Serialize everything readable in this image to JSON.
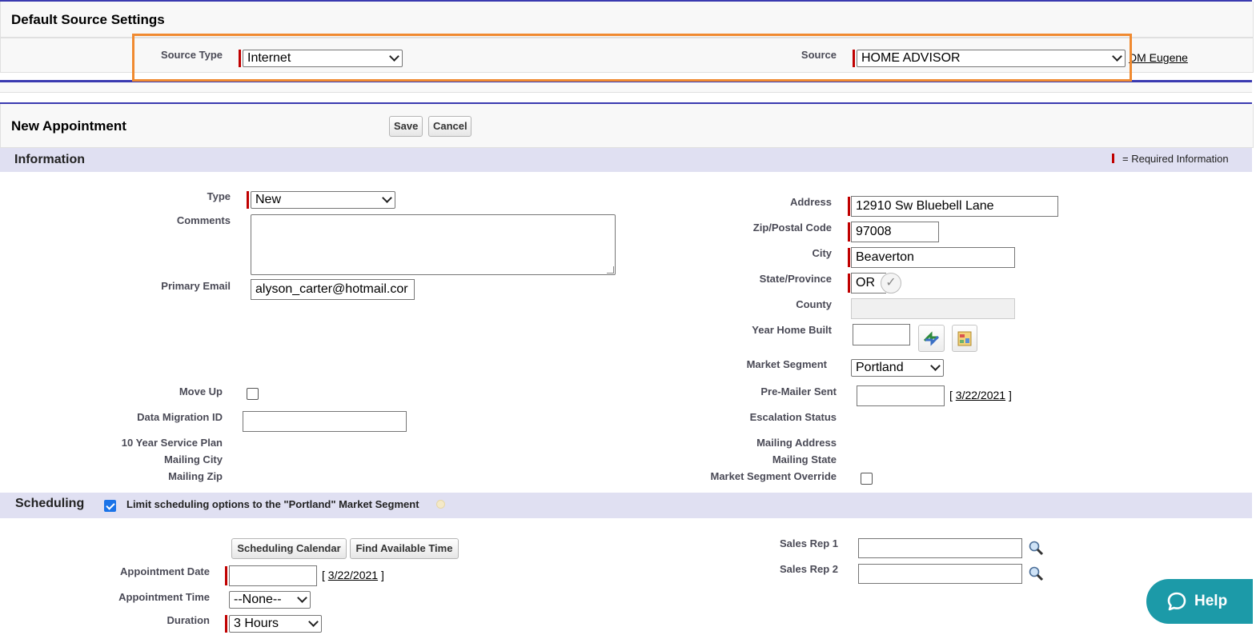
{
  "default_source": {
    "title": "Default Source Settings",
    "source_type_label": "Source Type",
    "source_type_value": "Internet",
    "source_label": "Source",
    "source_value": "HOME ADVISOR",
    "dm_link": "DM Eugene"
  },
  "appointment": {
    "title": "New Appointment",
    "save_label": "Save",
    "cancel_label": "Cancel"
  },
  "information": {
    "title": "Information",
    "required_note": "= Required Information",
    "left": {
      "type_label": "Type",
      "type_value": "New",
      "comments_label": "Comments",
      "comments_value": "",
      "email_label": "Primary Email",
      "email_value": "alyson_carter@hotmail.cor",
      "move_up_label": "Move Up",
      "data_migration_label": "Data Migration ID",
      "data_migration_value": "",
      "service_plan_label": "10 Year Service Plan",
      "mailing_city_label": "Mailing City",
      "mailing_zip_label": "Mailing Zip"
    },
    "right": {
      "address_label": "Address",
      "address_value": "12910 Sw Bluebell Lane",
      "zip_label": "Zip/Postal Code",
      "zip_value": "97008",
      "city_label": "City",
      "city_value": "Beaverton",
      "state_label": "State/Province",
      "state_value": "OR",
      "county_label": "County",
      "county_value": "",
      "year_built_label": "Year Home Built",
      "year_built_value": "",
      "market_segment_label": "Market Segment",
      "market_segment_value": "Portland",
      "pre_mailer_label": "Pre-Mailer Sent",
      "pre_mailer_value": "",
      "pre_mailer_date_link": "3/22/2021",
      "escalation_label": "Escalation Status",
      "mailing_address_label": "Mailing Address",
      "mailing_state_label": "Mailing State",
      "segment_override_label": "Market Segment Override"
    }
  },
  "scheduling": {
    "title": "Scheduling",
    "limit_label": "Limit scheduling options to the \"Portland\" Market Segment",
    "calendar_button": "Scheduling Calendar",
    "find_time_button": "Find Available Time",
    "appt_date_label": "Appointment Date",
    "appt_date_value": "",
    "appt_date_link": "3/22/2021",
    "appt_time_label": "Appointment Time",
    "appt_time_value": "--None--",
    "duration_label": "Duration",
    "duration_value": "3 Hours",
    "sales_rep1_label": "Sales Rep 1",
    "sales_rep1_value": "",
    "sales_rep2_label": "Sales Rep 2",
    "sales_rep2_value": ""
  },
  "help": {
    "label": "Help"
  },
  "colors": {
    "accent_bar": "#3a3ab0",
    "highlight": "#f08a30",
    "required": "#c00000",
    "help_bg": "#1c9aa8",
    "section_band": "#e0e0f2"
  }
}
